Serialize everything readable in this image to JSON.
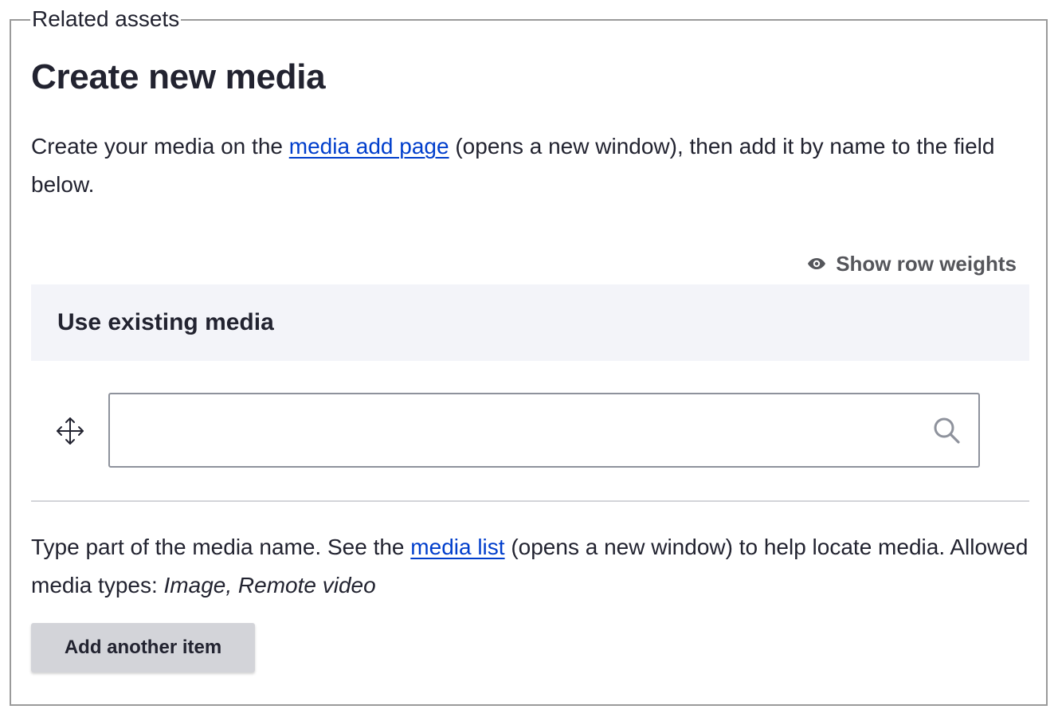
{
  "fieldset": {
    "legend": "Related assets"
  },
  "heading": "Create new media",
  "intro": {
    "before_link": "Create your media on the ",
    "link_text": "media add page",
    "after_link": " (opens a new window), then add it by name to the field below."
  },
  "row_weights": {
    "icon": "eye-icon",
    "label": "Show row weights"
  },
  "table": {
    "header": "Use existing media",
    "row": {
      "drag_icon": "move-arrows-icon",
      "search_value": "",
      "search_placeholder": "",
      "search_icon": "search-icon"
    }
  },
  "help": {
    "before_link": "Type part of the media name. See the ",
    "link_text": "media list",
    "after_link": " (opens a new window) to help locate media. Allowed media types: ",
    "types": "Image, Remote video"
  },
  "add_button": {
    "label": "Add another item"
  },
  "colors": {
    "link": "#003ecc",
    "header_bg": "#f3f4f9",
    "button_bg": "#d3d4d9",
    "text": "#222330",
    "muted_text": "#55565b"
  }
}
